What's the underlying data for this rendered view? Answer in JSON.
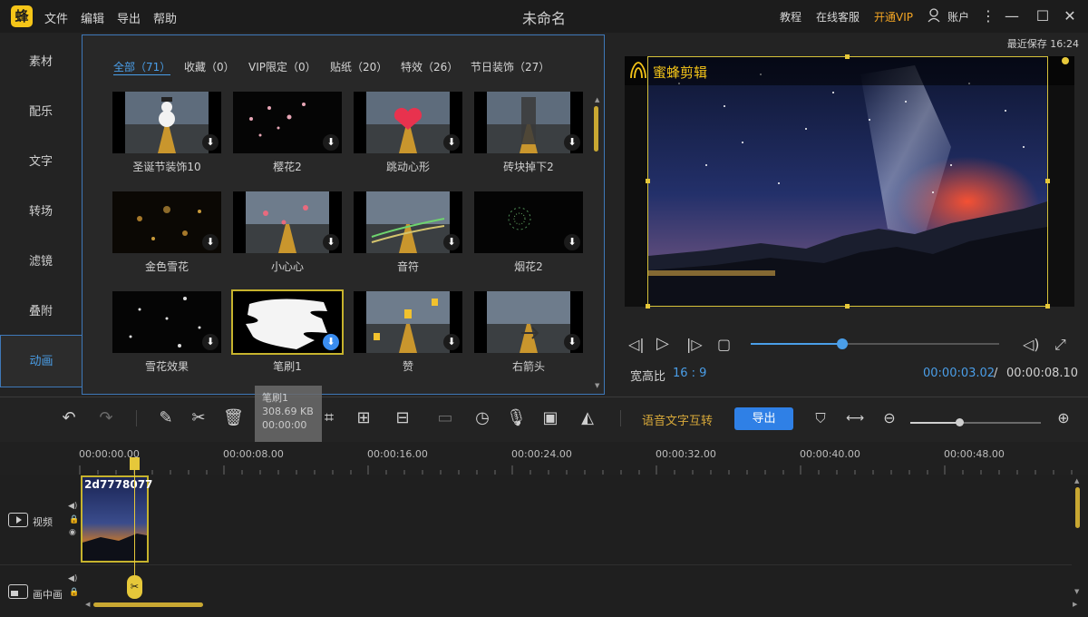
{
  "titlebar": {
    "logo_text": "蜂",
    "menus": [
      "文件",
      "编辑",
      "导出",
      "帮助"
    ],
    "doc_title": "未命名",
    "tutorial": "教程",
    "support": "在线客服",
    "vip": "开通VIP",
    "account": "账户",
    "vip_color": "#f5a623"
  },
  "sidebar": {
    "items": [
      {
        "label": "素材"
      },
      {
        "label": "配乐"
      },
      {
        "label": "文字"
      },
      {
        "label": "转场"
      },
      {
        "label": "滤镜"
      },
      {
        "label": "叠附"
      },
      {
        "label": "动画"
      }
    ],
    "active_index": 6
  },
  "library": {
    "tabs": [
      {
        "label": "全部（71）"
      },
      {
        "label": "收藏（0）"
      },
      {
        "label": "VIP限定（0）"
      },
      {
        "label": "贴纸（20）"
      },
      {
        "label": "特效（26）"
      },
      {
        "label": "节日装饰（27）"
      }
    ],
    "items": [
      {
        "label": "圣诞节装饰10",
        "icon": "download-icon"
      },
      {
        "label": "樱花2",
        "icon": "download-icon"
      },
      {
        "label": "跳动心形",
        "icon": "download-icon"
      },
      {
        "label": "砖块掉下2",
        "icon": "download-icon"
      },
      {
        "label": "金色雪花",
        "icon": "download-icon"
      },
      {
        "label": "小心心",
        "icon": "download-icon"
      },
      {
        "label": "音符",
        "icon": "download-icon"
      },
      {
        "label": "烟花2",
        "icon": "download-icon"
      },
      {
        "label": "雪花效果",
        "icon": "download-icon"
      },
      {
        "label": "笔刷1",
        "icon": "download-icon"
      },
      {
        "label": "赞",
        "icon": "download-icon"
      },
      {
        "label": "右箭头",
        "icon": "download-icon"
      }
    ],
    "selected_index": 9
  },
  "tooltip": {
    "name": "笔刷1",
    "size": "308.69 KB",
    "duration": "00:00:00"
  },
  "preview": {
    "save_status": "最近保存 16:24",
    "brand": "蜜蜂剪辑",
    "ratio_label": "宽高比",
    "ratio_value": "16 : 9",
    "current_time": "00:00:03.02",
    "separator": "/",
    "total_time": "00:00:08.10",
    "progress": 0.37
  },
  "toolbar": {
    "speech_to_text": "语音文字互转",
    "export": "导出",
    "zoom_level": 0.375
  },
  "timeline": {
    "ticks": [
      "00:00:00.00",
      "00:00:08.00",
      "00:00:16.00",
      "00:00:24.00",
      "00:00:32.00",
      "00:00:40.00",
      "00:00:48.00"
    ],
    "tracks": [
      {
        "label": "视频"
      },
      {
        "label": "画中画"
      }
    ],
    "clip_name": "2d7778077"
  }
}
